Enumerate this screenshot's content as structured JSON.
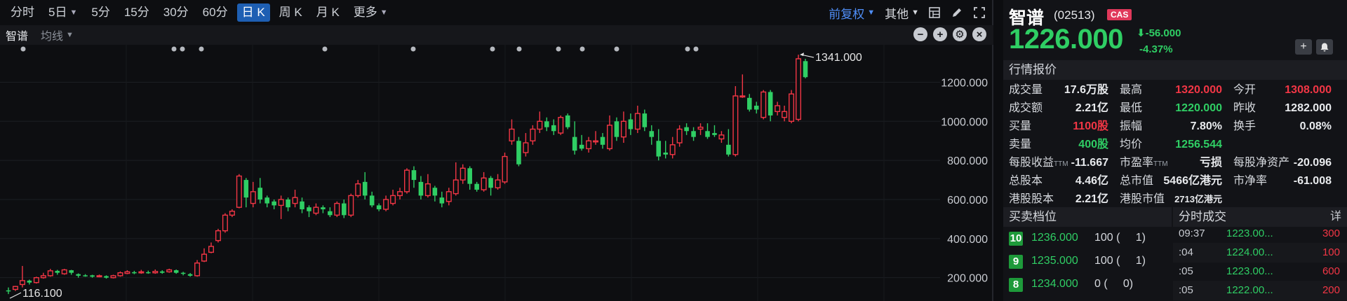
{
  "timeframes": [
    {
      "label": "分时",
      "dropdown": false,
      "active": false
    },
    {
      "label": "5日",
      "dropdown": true,
      "active": false
    },
    {
      "label": "5分",
      "dropdown": false,
      "active": false
    },
    {
      "label": "15分",
      "dropdown": false,
      "active": false
    },
    {
      "label": "30分",
      "dropdown": false,
      "active": false
    },
    {
      "label": "60分",
      "dropdown": false,
      "active": false
    },
    {
      "label": "日 K",
      "dropdown": false,
      "active": true
    },
    {
      "label": "周 K",
      "dropdown": false,
      "active": false
    },
    {
      "label": "月 K",
      "dropdown": false,
      "active": false
    },
    {
      "label": "更多",
      "dropdown": true,
      "active": false
    }
  ],
  "toolbar": {
    "adjust_label": "前复权",
    "other_label": "其他",
    "icons": [
      "layout-grid-icon",
      "pen-icon",
      "fullscreen-icon"
    ]
  },
  "subbar": {
    "stock_label": "智谱",
    "ma_label": "均线",
    "icons": [
      {
        "name": "zoom-out-icon",
        "glyph": "−"
      },
      {
        "name": "zoom-in-icon",
        "glyph": "+"
      },
      {
        "name": "settings-icon",
        "glyph": "⚙"
      },
      {
        "name": "close-icon",
        "glyph": "×"
      }
    ]
  },
  "chart_data": {
    "type": "candlestick",
    "title": "",
    "y_ticks": [
      "200.000",
      "400.000",
      "600.000",
      "800.000",
      "1000.000",
      "1200.000"
    ],
    "ylim": [
      95,
      1370
    ],
    "grid": true,
    "high_label": "1341.000",
    "low_label": "116.100",
    "up_color": "#f23645",
    "down_color": "#2fce64",
    "candles": [
      [
        135,
        130,
        150,
        116.1
      ],
      [
        140,
        155,
        158,
        132
      ],
      [
        165,
        185,
        260,
        150
      ],
      [
        185,
        175,
        190,
        165
      ],
      [
        175,
        200,
        205,
        170
      ],
      [
        200,
        210,
        225,
        195
      ],
      [
        210,
        235,
        245,
        205
      ],
      [
        235,
        225,
        240,
        215
      ],
      [
        220,
        240,
        245,
        215
      ],
      [
        238,
        225,
        240,
        215
      ],
      [
        218,
        210,
        222,
        200
      ],
      [
        212,
        210,
        218,
        205
      ],
      [
        212,
        205,
        215,
        200
      ],
      [
        205,
        210,
        216,
        202
      ],
      [
        208,
        200,
        212,
        195
      ],
      [
        200,
        210,
        215,
        196
      ],
      [
        210,
        225,
        232,
        205
      ],
      [
        222,
        230,
        238,
        218
      ],
      [
        228,
        225,
        235,
        218
      ],
      [
        225,
        230,
        240,
        220
      ],
      [
        228,
        225,
        236,
        220
      ],
      [
        225,
        232,
        242,
        220
      ],
      [
        232,
        225,
        238,
        220
      ],
      [
        230,
        240,
        246,
        225
      ],
      [
        238,
        225,
        242,
        220
      ],
      [
        225,
        220,
        230,
        212
      ],
      [
        218,
        210,
        224,
        205
      ],
      [
        210,
        275,
        290,
        205
      ],
      [
        285,
        320,
        350,
        280
      ],
      [
        330,
        360,
        380,
        325
      ],
      [
        390,
        440,
        450,
        380
      ],
      [
        440,
        520,
        530,
        430
      ],
      [
        520,
        540,
        550,
        510
      ],
      [
        560,
        720,
        730,
        555
      ],
      [
        700,
        610,
        710,
        560
      ],
      [
        580,
        640,
        690,
        560
      ],
      [
        660,
        600,
        710,
        580
      ],
      [
        610,
        580,
        620,
        560
      ],
      [
        590,
        570,
        600,
        550
      ],
      [
        570,
        600,
        620,
        500
      ],
      [
        600,
        560,
        610,
        540
      ],
      [
        580,
        610,
        650,
        560
      ],
      [
        590,
        550,
        610,
        530
      ],
      [
        560,
        540,
        570,
        510
      ],
      [
        530,
        560,
        580,
        520
      ],
      [
        560,
        550,
        570,
        530
      ],
      [
        540,
        520,
        560,
        510
      ],
      [
        520,
        580,
        590,
        510
      ],
      [
        580,
        520,
        600,
        505
      ],
      [
        520,
        620,
        630,
        510
      ],
      [
        620,
        680,
        700,
        610
      ],
      [
        690,
        620,
        740,
        600
      ],
      [
        620,
        570,
        640,
        560
      ],
      [
        570,
        550,
        580,
        540
      ],
      [
        550,
        600,
        620,
        540
      ],
      [
        580,
        620,
        650,
        570
      ],
      [
        620,
        640,
        660,
        600
      ],
      [
        640,
        750,
        760,
        630
      ],
      [
        750,
        700,
        770,
        660
      ],
      [
        690,
        620,
        720,
        600
      ],
      [
        620,
        680,
        730,
        610
      ],
      [
        660,
        620,
        670,
        590
      ],
      [
        610,
        580,
        640,
        560
      ],
      [
        590,
        640,
        660,
        570
      ],
      [
        630,
        700,
        790,
        620
      ],
      [
        700,
        760,
        780,
        680
      ],
      [
        760,
        680,
        770,
        650
      ],
      [
        680,
        650,
        690,
        640
      ],
      [
        650,
        710,
        740,
        640
      ],
      [
        710,
        660,
        720,
        620
      ],
      [
        660,
        700,
        730,
        650
      ],
      [
        690,
        820,
        840,
        680
      ],
      [
        900,
        960,
        1010,
        880
      ],
      [
        900,
        780,
        920,
        770
      ],
      [
        840,
        890,
        940,
        820
      ],
      [
        900,
        960,
        980,
        880
      ],
      [
        960,
        1000,
        1050,
        940
      ],
      [
        1000,
        970,
        1020,
        950
      ],
      [
        980,
        950,
        1010,
        930
      ],
      [
        940,
        1020,
        1030,
        930
      ],
      [
        1030,
        970,
        1040,
        960
      ],
      [
        920,
        850,
        1000,
        830
      ],
      [
        880,
        860,
        930,
        850
      ],
      [
        860,
        900,
        920,
        840
      ],
      [
        900,
        900,
        950,
        880
      ],
      [
        920,
        880,
        940,
        860
      ],
      [
        860,
        980,
        1030,
        850
      ],
      [
        1000,
        920,
        1020,
        900
      ],
      [
        920,
        1000,
        1050,
        890
      ],
      [
        1010,
        960,
        1040,
        930
      ],
      [
        960,
        1040,
        1080,
        940
      ],
      [
        1040,
        970,
        1060,
        950
      ],
      [
        950,
        920,
        980,
        880
      ],
      [
        900,
        820,
        960,
        800
      ],
      [
        840,
        830,
        900,
        810
      ],
      [
        830,
        880,
        920,
        810
      ],
      [
        890,
        960,
        980,
        870
      ],
      [
        970,
        950,
        990,
        930
      ],
      [
        950,
        920,
        970,
        900
      ],
      [
        960,
        970,
        990,
        930
      ],
      [
        950,
        920,
        990,
        910
      ],
      [
        940,
        930,
        980,
        920
      ],
      [
        910,
        930,
        950,
        890
      ],
      [
        880,
        830,
        960,
        820
      ],
      [
        830,
        1130,
        1180,
        820
      ],
      [
        1130,
        1130,
        1240,
        1120
      ],
      [
        1120,
        1060,
        1140,
        1050
      ],
      [
        1080,
        1060,
        1100,
        1040
      ],
      [
        1020,
        1150,
        1160,
        1010
      ],
      [
        1150,
        1030,
        1160,
        1000
      ],
      [
        1050,
        1080,
        1100,
        1030
      ],
      [
        1020,
        1050,
        1080,
        1000
      ],
      [
        1000,
        1140,
        1160,
        990
      ],
      [
        1010,
        1320,
        1341,
        1000
      ],
      [
        1308,
        1226,
        1320,
        1220
      ]
    ]
  },
  "stock": {
    "name": "智谱",
    "code": "(02513)",
    "badge": "CAS",
    "price": "1226.000",
    "change": "-56.000",
    "change_pct": "-4.37%",
    "change_arrow": "⬇"
  },
  "quote_title": "行情报价",
  "quote_rows": [
    [
      {
        "l": "成交量",
        "v": "17.6万股"
      },
      {
        "l": "最高",
        "v": "1320.000",
        "c": "red"
      },
      {
        "l": "今开",
        "v": "1308.000",
        "c": "red"
      }
    ],
    [
      {
        "l": "成交额",
        "v": "2.21亿"
      },
      {
        "l": "最低",
        "v": "1220.000",
        "c": "green"
      },
      {
        "l": "昨收",
        "v": "1282.000"
      }
    ],
    [
      {
        "l": "买量",
        "v": "1100股",
        "c": "red"
      },
      {
        "l": "振幅",
        "v": "7.80%"
      },
      {
        "l": "换手",
        "v": "0.08%"
      }
    ],
    [
      {
        "l": "卖量",
        "v": "400股",
        "c": "green"
      },
      {
        "l": "均价",
        "v": "1256.544",
        "c": "green"
      },
      {
        "l": "",
        "v": ""
      }
    ],
    [
      {
        "l": "每股收益",
        "s": "TTM",
        "v": "-11.667"
      },
      {
        "l": "市盈率",
        "s": "TTM",
        "v": "亏损"
      },
      {
        "l": "每股净资产",
        "v": "-20.096"
      }
    ],
    [
      {
        "l": "总股本",
        "v": "4.46亿"
      },
      {
        "l": "总市值",
        "v": "5466亿港元"
      },
      {
        "l": "市净率",
        "v": "-61.008"
      }
    ],
    [
      {
        "l": "港股股本",
        "v": "2.21亿"
      },
      {
        "l": "港股市值",
        "v": "2713亿港元",
        "small": true
      },
      {
        "l": "",
        "v": ""
      }
    ]
  ],
  "orderbook": {
    "title": "买卖档位",
    "rows": [
      {
        "level": "10",
        "price": "1236.000",
        "qty": "100 (     1)"
      },
      {
        "level": "9",
        "price": "1235.000",
        "qty": "100 (     1)"
      },
      {
        "level": "8",
        "price": "1234.000",
        "qty": "0 (     0)"
      }
    ]
  },
  "timesales": {
    "title": "分时成交",
    "detail": "详",
    "rows": [
      {
        "time": "09:37",
        "price": "1223.00...",
        "vol": "300"
      },
      {
        "time": ":04",
        "price": "1224.00...",
        "vol": "100"
      },
      {
        "time": ":05",
        "price": "1223.00...",
        "vol": "600"
      },
      {
        "time": ":05",
        "price": "1222.00...",
        "vol": "200"
      }
    ]
  }
}
